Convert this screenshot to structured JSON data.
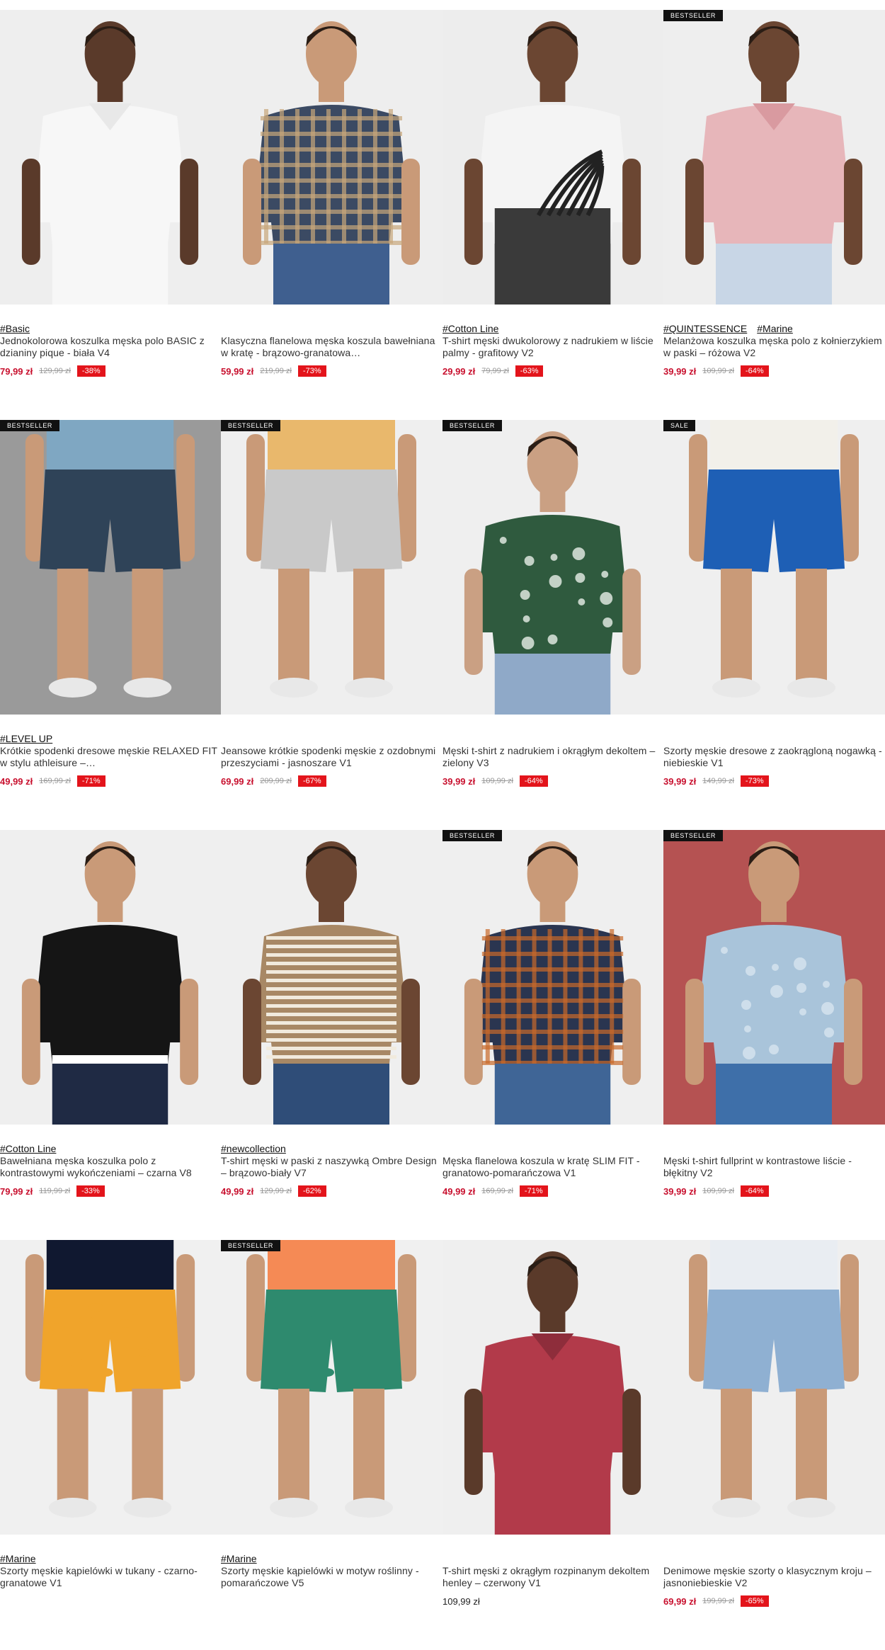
{
  "products": [
    {
      "badge": "",
      "tags": [
        "#Basic"
      ],
      "name": "Jednokolorowa koszulka męska polo BASIC z dzianiny pique - biała V4",
      "price": "79,99 zł",
      "old_price": "129,99 zł",
      "discount": "-38%",
      "icon": "white-polo-photo",
      "colors": {
        "bg": "#eeeeee",
        "skin": "#5a3a2a",
        "garment": "#f7f7f7",
        "garment2": "#e8e8e8",
        "pants": "#f7f7f7"
      }
    },
    {
      "badge": "",
      "tags": [],
      "name": "Klasyczna flanelowa męska koszula bawełniana w kratę - brązowo-granatowa…",
      "price": "59,99 zł",
      "old_price": "219,99 zł",
      "discount": "-73%",
      "icon": "plaid-shirt-photo",
      "colors": {
        "bg": "#eeeeee",
        "skin": "#c99a78",
        "garment": "#3b4a63",
        "garment2": "#c7a67a",
        "pants": "#3f5f8f"
      }
    },
    {
      "badge": "",
      "tags": [
        "#Cotton Line"
      ],
      "name": "T-shirt męski dwukolorowy z nadrukiem w liście palmy - grafitowy V2",
      "price": "29,99 zł",
      "old_price": "79,99 zł",
      "discount": "-63%",
      "icon": "palm-tshirt-photo",
      "colors": {
        "bg": "#ededed",
        "skin": "#6b4632",
        "garment": "#f4f4f4",
        "garment2": "#3a3a3a",
        "pants": "#3a3a3a"
      }
    },
    {
      "badge": "BESTSELLER",
      "tags": [
        "#QUINTESSENCE",
        "#Marine"
      ],
      "name": "Melanżowa koszulka męska polo z kołnierzykiem w paski – różowa V2",
      "price": "39,99 zł",
      "old_price": "109,99 zł",
      "discount": "-64%",
      "icon": "pink-polo-photo",
      "colors": {
        "bg": "#eeeeee",
        "skin": "#6b4632",
        "garment": "#e7b6ba",
        "garment2": "#d99aa0",
        "pants": "#c8d6e6"
      }
    },
    {
      "badge": "BESTSELLER",
      "tags": [
        "#LEVEL UP"
      ],
      "name": "Krótkie spodenki dresowe męskie RELAXED FIT w stylu athleisure –…",
      "price": "49,99 zł",
      "old_price": "169,99 zł",
      "discount": "-71%",
      "icon": "navy-shorts-photo",
      "colors": {
        "bg": "#9a9a9a",
        "skin": "#c99a78",
        "garment": "#7fa7c2",
        "garment2": "#2f4358",
        "pants": "#2f4358"
      }
    },
    {
      "badge": "BESTSELLER",
      "tags": [],
      "name": "Jeansowe krótkie spodenki męskie z ozdobnymi przeszyciami - jasnoszare V1",
      "price": "69,99 zł",
      "old_price": "209,99 zł",
      "discount": "-67%",
      "icon": "grey-denim-shorts-photo",
      "colors": {
        "bg": "#efefef",
        "skin": "#c99a78",
        "garment": "#e9b86c",
        "garment2": "#c9c9c9",
        "pants": "#c9c9c9"
      }
    },
    {
      "badge": "BESTSELLER",
      "tags": [],
      "name": "Męski t-shirt z nadrukiem i okrągłym dekoltem – zielony V3",
      "price": "39,99 zł",
      "old_price": "109,99 zł",
      "discount": "-64%",
      "icon": "green-tshirt-photo",
      "colors": {
        "bg": "#efefef",
        "skin": "#caa083",
        "garment": "#2f5a3e",
        "garment2": "#e8efe9",
        "pants": "#8fa9c8"
      }
    },
    {
      "badge": "SALE",
      "tags": [],
      "name": "Szorty męskie dresowe z zaokrągloną nogawką - niebieskie V1",
      "price": "39,99 zł",
      "old_price": "149,99 zł",
      "discount": "-73%",
      "icon": "blue-sweat-shorts-photo",
      "colors": {
        "bg": "#efefef",
        "skin": "#c99a78",
        "garment": "#f2f0ea",
        "garment2": "#1e5fb5",
        "pants": "#1e5fb5"
      }
    },
    {
      "badge": "",
      "tags": [
        "#Cotton Line"
      ],
      "name": "Bawełniana męska koszulka polo z kontrastowymi wykończeniami – czarna V8",
      "price": "79,99 zł",
      "old_price": "119,99 zł",
      "discount": "-33%",
      "icon": "black-polo-photo",
      "colors": {
        "bg": "#efefef",
        "skin": "#c99a78",
        "garment": "#151515",
        "garment2": "#ffffff",
        "pants": "#1f2a44"
      }
    },
    {
      "badge": "",
      "tags": [
        "#newcollection"
      ],
      "name": "T-shirt męski w paski z naszywką Ombre Design – brązowo-biały V7",
      "price": "49,99 zł",
      "old_price": "129,99 zł",
      "discount": "-62%",
      "icon": "striped-tshirt-photo",
      "colors": {
        "bg": "#efefef",
        "skin": "#6b4632",
        "garment": "#a88865",
        "garment2": "#f1eadd",
        "pants": "#2f4d78"
      }
    },
    {
      "badge": "BESTSELLER",
      "tags": [],
      "name": "Męska flanelowa koszula w kratę SLIM FIT - granatowo-pomarańczowa V1",
      "price": "49,99 zł",
      "old_price": "169,99 zł",
      "discount": "-71%",
      "icon": "check-shirt-photo",
      "colors": {
        "bg": "#efefef",
        "skin": "#c99a78",
        "garment": "#2a3550",
        "garment2": "#c96a2a",
        "pants": "#3f6596"
      }
    },
    {
      "badge": "BESTSELLER",
      "tags": [],
      "name": "Męski t-shirt fullprint w kontrastowe liście - błękitny V2",
      "price": "39,99 zł",
      "old_price": "109,99 zł",
      "discount": "-64%",
      "icon": "leaf-print-tshirt-photo",
      "colors": {
        "bg": "#b55252",
        "skin": "#c99a78",
        "garment": "#a9c4da",
        "garment2": "#d7e5ef",
        "pants": "#3e6fa9"
      }
    },
    {
      "badge": "",
      "tags": [
        "#Marine"
      ],
      "name": "Szorty męskie kąpielówki w tukany - czarno-granatowe V1",
      "price": "",
      "old_price": "",
      "discount": "",
      "icon": "toucan-swim-shorts-photo",
      "colors": {
        "bg": "#f0f0f0",
        "skin": "#c99a78",
        "garment": "#101830",
        "garment2": "#f0a42b",
        "pants": "#101830"
      }
    },
    {
      "badge": "BESTSELLER",
      "tags": [
        "#Marine"
      ],
      "name": "Szorty męskie kąpielówki w motyw roślinny - pomarańczowe V5",
      "price": "",
      "old_price": "",
      "discount": "",
      "icon": "orange-swim-shorts-photo",
      "colors": {
        "bg": "#f0f0f0",
        "skin": "#c99a78",
        "garment": "#f58a55",
        "garment2": "#2e8a6e",
        "pants": "#f58a55"
      }
    },
    {
      "badge": "",
      "tags": [],
      "name": "T-shirt męski z okrągłym rozpinanym dekoltem henley – czerwony V1",
      "price": "109,99 zł",
      "old_price": "",
      "discount": "",
      "icon": "red-henley-photo",
      "colors": {
        "bg": "#efefef",
        "skin": "#5a3a2a",
        "garment": "#b23a4a",
        "garment2": "#8e2d3b",
        "pants": "#b23a4a"
      }
    },
    {
      "badge": "",
      "tags": [],
      "name": "Denimowe męskie szorty o klasycznym kroju – jasnoniebieskie V2",
      "price": "69,99 zł",
      "old_price": "199,99 zł",
      "discount": "-65%",
      "icon": "light-denim-shorts-photo",
      "colors": {
        "bg": "#efefef",
        "skin": "#c99a78",
        "garment": "#e9edf2",
        "garment2": "#8fb0d2",
        "pants": "#8fb0d2"
      }
    }
  ]
}
